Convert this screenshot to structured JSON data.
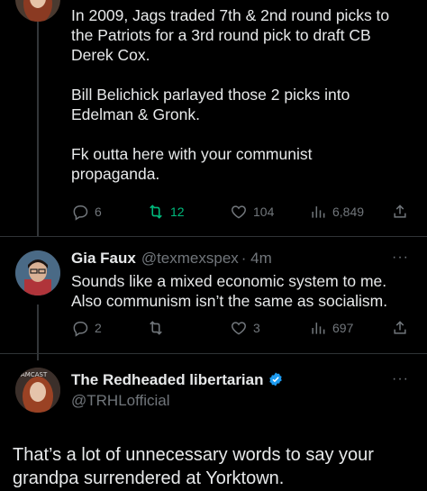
{
  "tweet1": {
    "text": "In 2009, Jags traded 7th & 2nd round picks to\nthe Patriots for a 3rd round pick to draft CB\nDerek Cox.\n\nBill Belichick parlayed those 2 picks into\nEdelman & Gronk.\n\nFk outta here with your communist\npropaganda.",
    "replies": "6",
    "retweets": "12",
    "likes": "104",
    "views": "6,849"
  },
  "tweet2": {
    "name": "Gia Faux",
    "handle": "@texmexspex",
    "time": "· 4m",
    "text": "Sounds like a mixed economic system to me.\nAlso communism isn’t the same as socialism.",
    "replies": "2",
    "retweets": "",
    "likes": "3",
    "views": "697"
  },
  "tweet3": {
    "name": "The Redheaded libertarian",
    "handle": "@TRHLofficial",
    "text": "That’s a lot of unnecessary words to say your grandpa surrendered at Yorktown.",
    "avatar_label": "AMCAST"
  },
  "colors": {
    "background": "#000000",
    "text": "#e7e9ea",
    "muted": "#71767b",
    "retweet": "#00ba7c",
    "verified": "#1d9bf0"
  },
  "icons": {
    "reply": "reply-icon",
    "retweet": "retweet-icon",
    "like": "heart-icon",
    "views": "views-icon",
    "share": "share-icon",
    "more": "more-icon",
    "verified": "verified-badge-icon"
  },
  "more_label": "···"
}
